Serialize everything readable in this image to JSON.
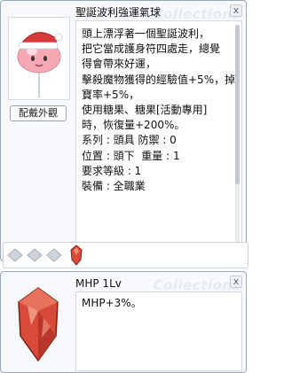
{
  "watermark": "Collections",
  "item": {
    "name": "聖誕波利強運氣球",
    "equip_button": "配戴外觀",
    "description_lines": [
      "頭上漂浮著一個聖誕波利，",
      "把它當成護身符四處走，總覺",
      "得會帶來好運，",
      "擊殺魔物獲得的經驗值+5%，掉",
      "寶率+5%，",
      "使用糖果、糖果[活動專用]",
      "時，恢復量+200%。",
      "系列 : 頭具 防禦 : 0",
      "位置 : 頭下  重量 : 1",
      "要求等級 : 1",
      "裝備 : 全職業"
    ],
    "close": "x",
    "scroll_position": 0
  },
  "card": {
    "name": "MHP 1Lv",
    "description": "MHP+3%。",
    "close": "x"
  },
  "colors": {
    "window_border": "#9aa6b6",
    "window_bg": "#f7f9fc",
    "poring_pink": "#f7a8b4",
    "hat_red": "#d83a3a",
    "gem_red": "#d84a3a"
  },
  "slots": {
    "filled": 1,
    "total": 4
  }
}
